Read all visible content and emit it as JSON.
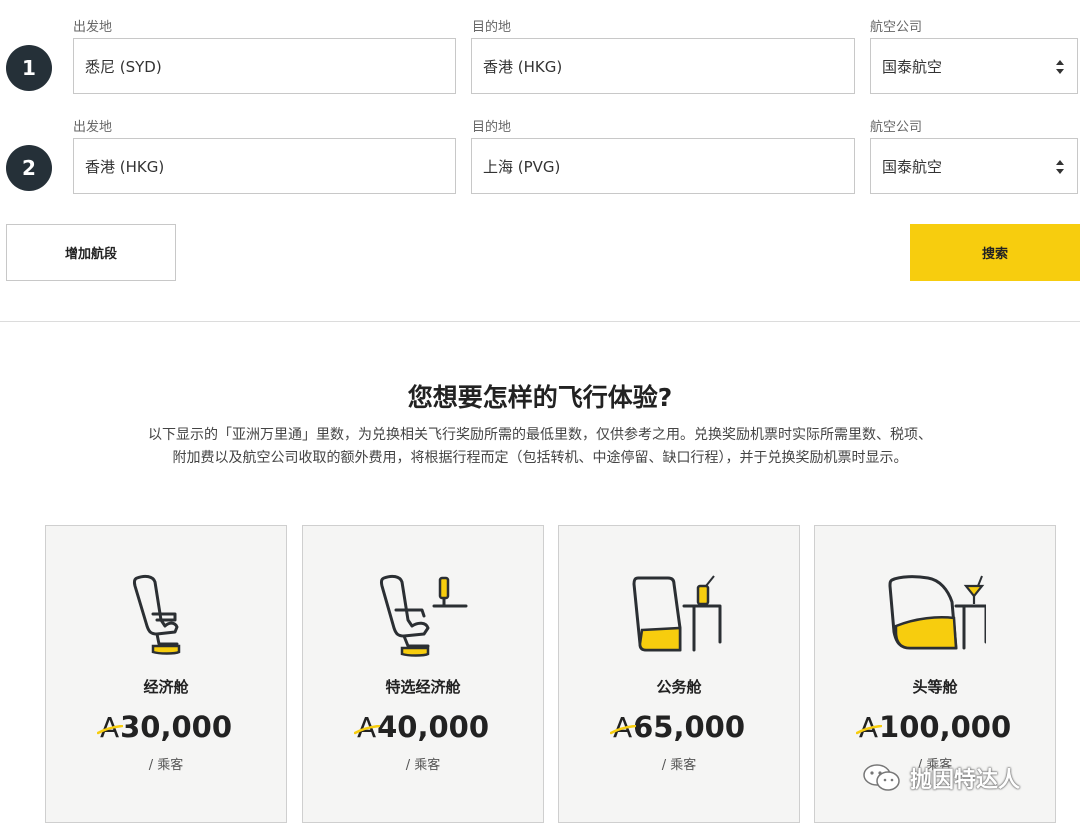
{
  "legs": [
    {
      "number": "1",
      "origin_label": "出发地",
      "origin_value": "悉尼 (SYD)",
      "destination_label": "目的地",
      "destination_value": "香港 (HKG)",
      "airline_label": "航空公司",
      "airline_value": "国泰航空"
    },
    {
      "number": "2",
      "origin_label": "出发地",
      "origin_value": "香港 (HKG)",
      "destination_label": "目的地",
      "destination_value": "上海 (PVG)",
      "airline_label": "航空公司",
      "airline_value": "国泰航空"
    }
  ],
  "actions": {
    "add_leg_label": "增加航段",
    "search_label": "搜索"
  },
  "section": {
    "heading": "您想要怎样的飞行体验?",
    "desc_line1": "以下显示的「亚洲万里通」里数，为兑换相关飞行奖励所需的最低里数，仅供参考之用。兑换奖励机票时实际所需里数、税项、",
    "desc_line2": "附加费以及航空公司收取的额外费用，将根据行程而定（包括转机、中途停留、缺口行程），并于兑换奖励机票时显示。"
  },
  "cabins": [
    {
      "name": "经济舱",
      "currency_symbol": "A",
      "miles": "30,000",
      "per": "/ 乘客",
      "icon": "economy-seat-icon"
    },
    {
      "name": "特选经济舱",
      "currency_symbol": "A",
      "miles": "40,000",
      "per": "/ 乘客",
      "icon": "premium-economy-seat-icon"
    },
    {
      "name": "公务舱",
      "currency_symbol": "A",
      "miles": "65,000",
      "per": "/ 乘客",
      "icon": "business-seat-icon"
    },
    {
      "name": "头等舱",
      "currency_symbol": "A",
      "miles": "100,000",
      "per": "/ 乘客",
      "icon": "first-class-seat-icon"
    }
  ],
  "watermark": {
    "text": "抛因特达人",
    "icon": "wechat-icon"
  },
  "colors": {
    "accent_yellow": "#f7cd0e",
    "leg_badge": "#253038",
    "card_background": "#f5f5f4"
  }
}
